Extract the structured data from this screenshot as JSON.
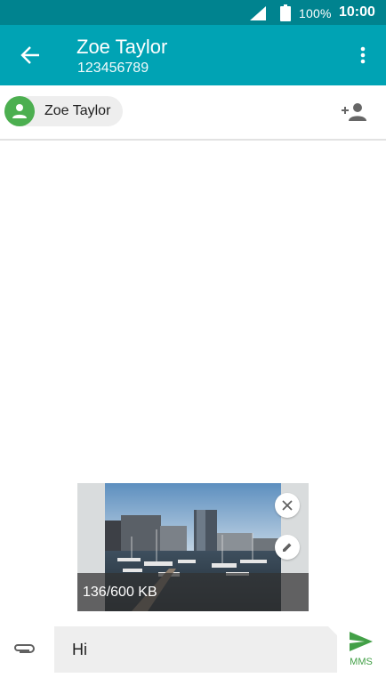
{
  "status_bar": {
    "battery_percent": "100%",
    "time": "10:00",
    "icons": [
      "signal-icon",
      "battery-icon"
    ]
  },
  "app_bar": {
    "title": "Zoe Taylor",
    "subtitle": "123456789",
    "icons": [
      "back-arrow-icon",
      "more-vert-icon"
    ]
  },
  "recipients": {
    "chips": [
      {
        "label": "Zoe Taylor",
        "icon": "person-icon"
      }
    ],
    "add_contact_icon": "person-add-icon"
  },
  "attachment": {
    "size_label": "136/600 KB",
    "icons": [
      "close-icon",
      "pencil-icon"
    ]
  },
  "composer": {
    "message_text": "Hi",
    "send_label": "MMS",
    "icons": [
      "paperclip-icon",
      "send-icon"
    ]
  },
  "colors": {
    "status_bar": "#00838f",
    "app_bar": "#00a3b4",
    "avatar": "#4caf50",
    "send": "#43a047"
  }
}
